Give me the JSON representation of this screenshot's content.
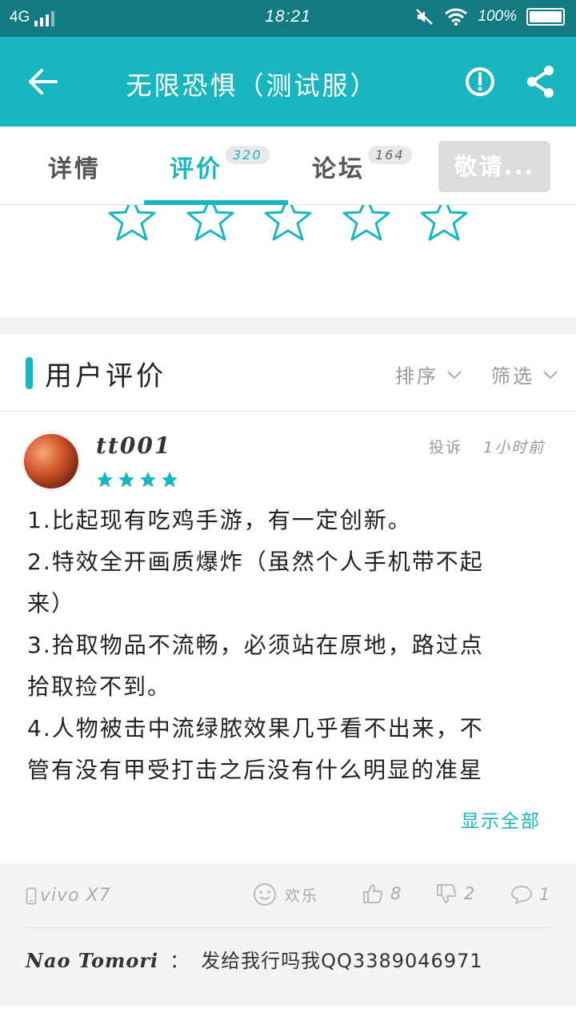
{
  "status_bar": {
    "network": "4G",
    "time": "18:21",
    "battery": "100%"
  },
  "header": {
    "title": "无限恐惧（测试服）",
    "back_icon": "arrow-left-icon",
    "report_icon": "exclamation-circle-icon",
    "share_icon": "share-icon",
    "bg_color": "#19b6c0"
  },
  "tabs": [
    {
      "label": "详情",
      "badge": ""
    },
    {
      "label": "评价",
      "badge": "320"
    },
    {
      "label": "论坛",
      "badge": "164"
    }
  ],
  "invite_button": "敬请...",
  "rating": {
    "stars_total": 5,
    "stars_selected": 0
  },
  "review_section": {
    "title": "用户评价",
    "sort_label": "排序",
    "filter_label": "筛选"
  },
  "review": {
    "username": "tt001",
    "rating": 4,
    "complaint_label": "投诉",
    "time": "1小时前",
    "lines": [
      "1.比起现有吃鸡手游，有一定创新。",
      "2.特效全开画质爆炸（虽然个人手机带不起",
      "来）",
      "3.拾取物品不流畅，必须站在原地，路过点",
      "拾取捡不到。",
      "4.人物被击中流绿脓效果几乎看不出来，不",
      "管有没有甲受打击之后没有什么明显的准星"
    ],
    "show_all": "显示全部",
    "device": "vivo X7",
    "mood": "欢乐",
    "likes": "8",
    "dislikes": "2",
    "comments": "1"
  },
  "reply": {
    "name": "Nao Tomori",
    "separator": "：",
    "text": "发给我行吗我QQ3389046971"
  },
  "colors": {
    "accent": "#19b6c0",
    "status_bar": "#127b82"
  }
}
